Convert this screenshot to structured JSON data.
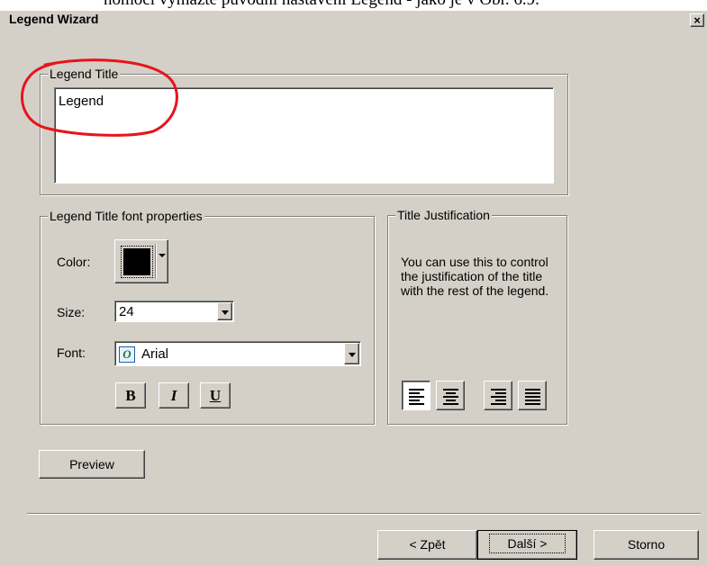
{
  "document_text": "nomocí vymažte původní nastavení Legend - jako je v Obr. 6.9.",
  "window": {
    "title": "Legend Wizard",
    "close_glyph": "×"
  },
  "title_group": {
    "label": "Legend Title",
    "value": "Legend"
  },
  "font_group": {
    "label": "Legend Title font properties",
    "color_label": "Color:",
    "color_value": "#000000",
    "size_label": "Size:",
    "size_value": "24",
    "font_label": "Font:",
    "font_value": "Arial",
    "font_icon": "opentype-font-icon",
    "bold_label": "B",
    "italic_label": "I",
    "underline_label": "U"
  },
  "justification_group": {
    "label": "Title Justification",
    "description": "You can use this to control the justification of the title with the rest of the legend.",
    "buttons": [
      {
        "icon": "align-left-icon",
        "pressed": true
      },
      {
        "icon": "align-center-icon",
        "pressed": false
      },
      {
        "icon": "align-right-icon",
        "pressed": false
      },
      {
        "icon": "align-justify-icon",
        "pressed": false
      }
    ]
  },
  "preview_button": "Preview",
  "footer": {
    "back": "< Zpět",
    "next": "Další >",
    "cancel": "Storno"
  },
  "colors": {
    "dialog_bg": "#d4d0c8",
    "annotation": "#e8141b",
    "field_bg": "#ffffff"
  }
}
